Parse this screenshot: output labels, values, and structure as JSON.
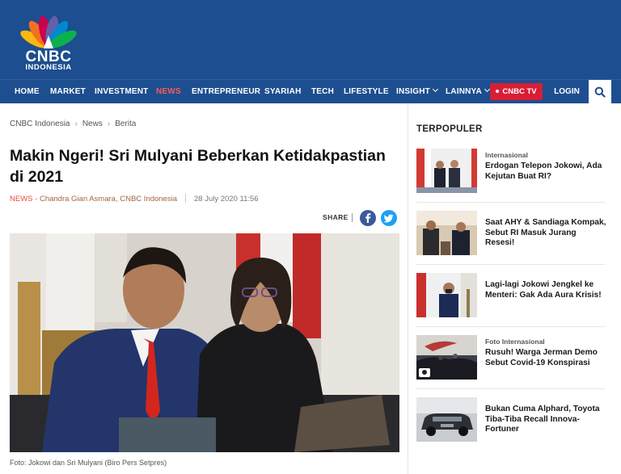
{
  "brand": {
    "name": "CNBC",
    "subname": "INDONESIA",
    "primary_color": "#1d4e8f",
    "accent_color": "#d71e35"
  },
  "nav": {
    "items": [
      {
        "label": "HOME",
        "active": false,
        "dropdown": false
      },
      {
        "label": "MARKET",
        "active": false,
        "dropdown": false
      },
      {
        "label": "INVESTMENT",
        "active": false,
        "dropdown": false
      },
      {
        "label": "NEWS",
        "active": true,
        "dropdown": false
      },
      {
        "label": "ENTREPRENEUR",
        "active": false,
        "dropdown": false
      },
      {
        "label": "SYARIAH",
        "active": false,
        "dropdown": false
      },
      {
        "label": "TECH",
        "active": false,
        "dropdown": false
      },
      {
        "label": "LIFESTYLE",
        "active": false,
        "dropdown": false
      },
      {
        "label": "INSIGHT",
        "active": false,
        "dropdown": true
      },
      {
        "label": "LAINNYA",
        "active": false,
        "dropdown": true
      }
    ],
    "tv_label": "CNBC TV",
    "login_label": "LOGIN",
    "search_icon": "search-icon"
  },
  "breadcrumb": [
    "CNBC Indonesia",
    "News",
    "Berita"
  ],
  "article": {
    "title": "Makin Ngeri! Sri Mulyani Beberkan Ketidakpastian di 2021",
    "category": "NEWS",
    "author": "Chandra Gian Asmara, CNBC Indonesia",
    "date": "28 July 2020 11:56",
    "share_label": "SHARE",
    "caption": "Foto: Jokowi dan Sri Mulyani (Biro Pers Setpres)"
  },
  "sidebar": {
    "heading": "TERPOPULER",
    "items": [
      {
        "category": "Internasional",
        "headline": "Erdogan Telepon Jokowi, Ada Kejutan Buat RI?"
      },
      {
        "category": "",
        "headline": "Saat AHY & Sandiaga Kompak, Sebut RI Masuk Jurang Resesi!"
      },
      {
        "category": "",
        "headline": "Lagi-lagi Jokowi Jengkel ke Menteri: Gak Ada Aura Krisis!"
      },
      {
        "category": "Foto Internasional",
        "headline": "Rusuh! Warga Jerman Demo Sebut Covid-19 Konspirasi"
      },
      {
        "category": "",
        "headline": "Bukan Cuma Alphard, Toyota Tiba-Tiba Recall Innova-Fortuner"
      }
    ]
  }
}
